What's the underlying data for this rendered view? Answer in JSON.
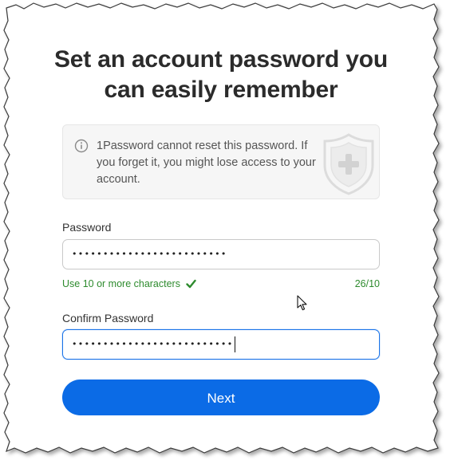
{
  "title_line1": "Set an account password you",
  "title_line2": "can easily remember",
  "notice": {
    "text": "1Password cannot reset this password. If you forget it, you might lose access to your account.",
    "icon": "info-icon",
    "decoration_icon": "shield-plus-icon"
  },
  "password": {
    "label": "Password",
    "masked_value": "•••••••••••••••••••••••••",
    "length": 25
  },
  "requirement": {
    "text": "Use 10 or more characters",
    "status_icon": "checkmark-icon",
    "counter": "26/10",
    "color": "#2e8b2e"
  },
  "confirm_password": {
    "label": "Confirm Password",
    "masked_value": "••••••••••••••••••••••••••",
    "length": 26
  },
  "next_button": {
    "label": "Next",
    "color": "#0b6be6"
  },
  "colors": {
    "focus": "#1a73e8",
    "title": "#2b2b2b"
  }
}
